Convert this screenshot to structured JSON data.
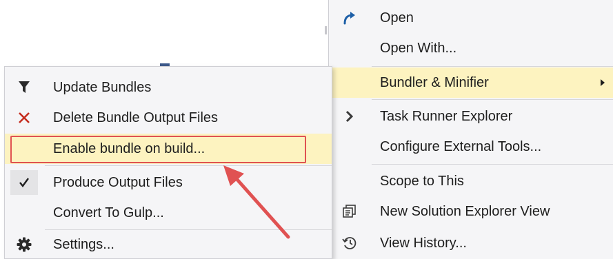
{
  "main_menu": {
    "items": [
      {
        "label": "Open",
        "icon": "redo-arrow-icon"
      },
      {
        "label": "Open With...",
        "icon": ""
      },
      {
        "label": "Bundler & Minifier",
        "icon": "",
        "has_submenu": true,
        "highlighted": true
      },
      {
        "label": "Task Runner Explorer",
        "icon": "chevron-right-icon"
      },
      {
        "label": "Configure External Tools...",
        "icon": ""
      },
      {
        "label": "Scope to This",
        "icon": ""
      },
      {
        "label": "New Solution Explorer View",
        "icon": "new-view-icon"
      },
      {
        "label": "View History...",
        "icon": "history-icon"
      }
    ]
  },
  "submenu": {
    "items": [
      {
        "label": "Update Bundles",
        "icon": "filter-icon"
      },
      {
        "label": "Delete Bundle Output Files",
        "icon": "delete-x-icon"
      },
      {
        "label": "Enable bundle on build...",
        "icon": "",
        "highlighted": true
      },
      {
        "label": "Produce Output Files",
        "icon": "checkmark-icon",
        "checked": true
      },
      {
        "label": "Convert To Gulp...",
        "icon": ""
      },
      {
        "label": "Settings...",
        "icon": "gear-icon"
      }
    ]
  },
  "colors": {
    "menu_background": "#f5f5f7",
    "highlight": "#fdf3c0",
    "annotation_red": "#e05252",
    "icon_blue": "#1d5fa7",
    "delete_red": "#c42b1c"
  }
}
